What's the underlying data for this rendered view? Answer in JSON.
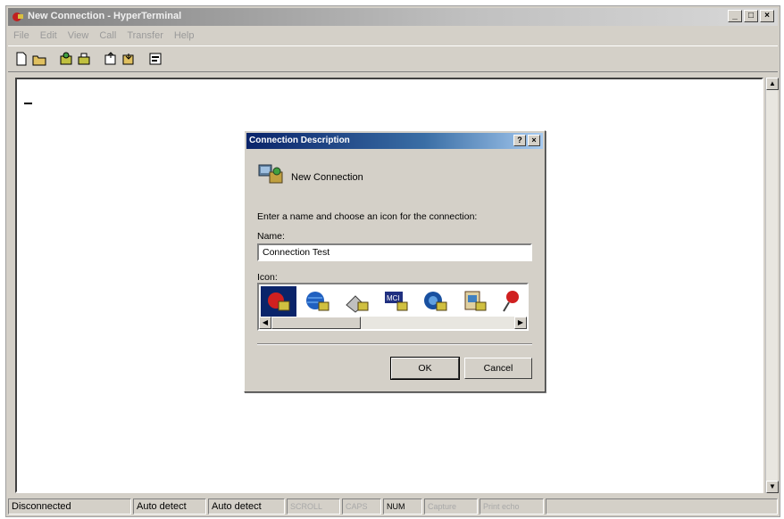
{
  "window": {
    "title": "New Connection - HyperTerminal",
    "controls": [
      "_",
      "□",
      "×"
    ]
  },
  "menubar": {
    "items": [
      "File",
      "Edit",
      "View",
      "Call",
      "Transfer",
      "Help"
    ]
  },
  "toolbar": {
    "buttons": [
      "new-icon",
      "open-icon",
      "connect-icon",
      "disconnect-icon",
      "send-icon",
      "receive-icon",
      "properties-icon"
    ]
  },
  "statusbar": {
    "cells": [
      "Disconnected",
      "Auto detect",
      "Auto detect",
      "SCROLL",
      "CAPS",
      "NUM",
      "Capture",
      "Print echo"
    ]
  },
  "dialog": {
    "title": "Connection Description",
    "help_btn": "?",
    "close_btn": "×",
    "header_label": "New Connection",
    "instruction": "Enter a name and choose an icon for the connection:",
    "name_label": "Name:",
    "name_value": "Connection Test",
    "icon_label": "Icon:",
    "ok_label": "OK",
    "cancel_label": "Cancel"
  },
  "colors": {
    "window_bg": "#d4d0c8",
    "dialog_title": "#0a246a",
    "selection": "#0a246a"
  }
}
